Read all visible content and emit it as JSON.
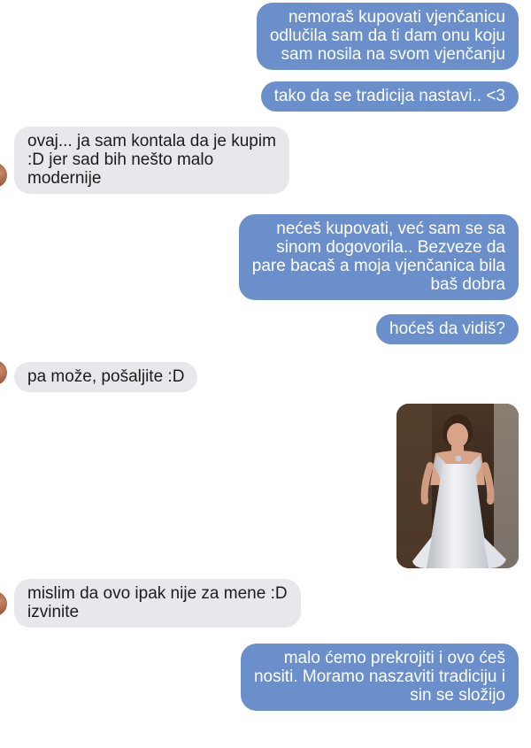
{
  "conversation": {
    "messages": [
      {
        "side": "sent",
        "text": "nemoraš kupovati vjenčanicu\nodlučila sam da ti dam onu koju\nsam nosila na svom vjenčanju"
      },
      {
        "side": "sent",
        "text": "tako da se tradicija nastavi.. <3"
      },
      {
        "side": "received",
        "text": "ovaj... ja sam kontala da je kupim\n:D jer sad bih nešto malo\nmodernije"
      },
      {
        "side": "sent",
        "text": "nećeš kupovati, već sam se sa\nsinom dogovorila.. Bezveze da\npare bacaš a moja vjenčanica bila\nbaš dobra"
      },
      {
        "side": "sent",
        "text": "hoćeš da vidiš?"
      },
      {
        "side": "received",
        "text": "pa može, pošaljite :D"
      },
      {
        "side": "sent",
        "type": "image",
        "image": "wedding-dress-photo"
      },
      {
        "side": "received",
        "text": "mislim da ovo ipak nije za mene :D\nizvinite"
      },
      {
        "side": "sent",
        "text": "malo ćemo prekrojiti i ovo ćeš\nnositi. Moramo naszaviti tradiciju i\nsin se složijo"
      }
    ]
  },
  "colors": {
    "sent_bubble": "#6b8fcb",
    "received_bubble": "#e8e8ec",
    "background": "#ffffff"
  }
}
